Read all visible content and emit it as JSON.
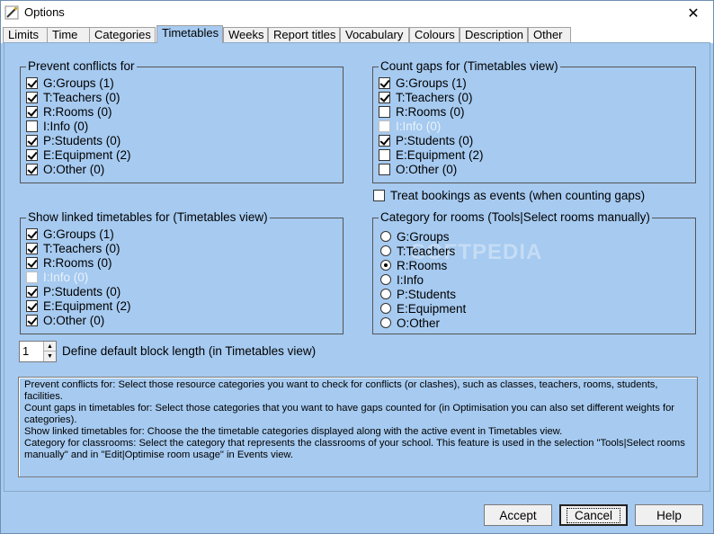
{
  "window": {
    "title": "Options",
    "close_symbol": "✕"
  },
  "tabs": [
    {
      "label": "Limits"
    },
    {
      "label": "Time"
    },
    {
      "label": "Categories"
    },
    {
      "label": "Timetables"
    },
    {
      "label": "Weeks"
    },
    {
      "label": "Report titles"
    },
    {
      "label": "Vocabulary"
    },
    {
      "label": "Colours"
    },
    {
      "label": "Description"
    },
    {
      "label": "Other"
    }
  ],
  "active_tab": "Timetables",
  "prevent_conflicts": {
    "title": "Prevent conflicts for",
    "items": [
      {
        "label": "G:Groups (1)",
        "checked": true,
        "enabled": true
      },
      {
        "label": "T:Teachers (0)",
        "checked": true,
        "enabled": true
      },
      {
        "label": "R:Rooms (0)",
        "checked": true,
        "enabled": true
      },
      {
        "label": "I:Info (0)",
        "checked": false,
        "enabled": true
      },
      {
        "label": "P:Students (0)",
        "checked": true,
        "enabled": true
      },
      {
        "label": "E:Equipment (2)",
        "checked": true,
        "enabled": true
      },
      {
        "label": "O:Other (0)",
        "checked": true,
        "enabled": true
      }
    ]
  },
  "count_gaps": {
    "title": "Count gaps for (Timetables view)",
    "items": [
      {
        "label": "G:Groups (1)",
        "checked": true,
        "enabled": true
      },
      {
        "label": "T:Teachers (0)",
        "checked": true,
        "enabled": true
      },
      {
        "label": "R:Rooms (0)",
        "checked": false,
        "enabled": true
      },
      {
        "label": "I:Info (0)",
        "checked": false,
        "enabled": false
      },
      {
        "label": "P:Students (0)",
        "checked": true,
        "enabled": true
      },
      {
        "label": "E:Equipment (2)",
        "checked": false,
        "enabled": true
      },
      {
        "label": "O:Other (0)",
        "checked": false,
        "enabled": true
      }
    ]
  },
  "treat_bookings": {
    "label": "Treat bookings as events (when counting gaps)",
    "checked": false
  },
  "show_linked": {
    "title": "Show linked timetables for (Timetables view)",
    "items": [
      {
        "label": "G:Groups (1)",
        "checked": true,
        "enabled": true
      },
      {
        "label": "T:Teachers (0)",
        "checked": true,
        "enabled": true
      },
      {
        "label": "R:Rooms (0)",
        "checked": true,
        "enabled": true
      },
      {
        "label": "I:Info (0)",
        "checked": false,
        "enabled": false
      },
      {
        "label": "P:Students (0)",
        "checked": true,
        "enabled": true
      },
      {
        "label": "E:Equipment (2)",
        "checked": true,
        "enabled": true
      },
      {
        "label": "O:Other (0)",
        "checked": true,
        "enabled": true
      }
    ]
  },
  "category_rooms": {
    "title": "Category for rooms (Tools|Select rooms manually)",
    "selected": "R:Rooms",
    "options": [
      {
        "label": "G:Groups"
      },
      {
        "label": "T:Teachers"
      },
      {
        "label": "R:Rooms"
      },
      {
        "label": "I:Info"
      },
      {
        "label": "P:Students"
      },
      {
        "label": "E:Equipment"
      },
      {
        "label": "O:Other"
      }
    ]
  },
  "block_length": {
    "value": "1",
    "label": "Define default block length (in Timetables view)"
  },
  "description": {
    "lines": [
      "Prevent conflicts for: Select those resource categories you want to check for conflicts (or clashes), such as classes, teachers, rooms, students, facilities.",
      "Count gaps in timetables for: Select those categories that you want to have gaps counted for (in Optimisation you can also set different weights for categories).",
      "Show linked timetables for: Choose the the timetable categories displayed along with the active event in Timetables view.",
      "Category for classrooms: Select the category that represents the classrooms of your school. This feature is used in the selection \"Tools|Select rooms manually\" and in \"Edit|Optimise room usage\" in Events view."
    ]
  },
  "buttons": {
    "accept": "Accept",
    "cancel": "Cancel",
    "help": "Help"
  },
  "watermark": "SOFTPEDIA",
  "colors": {
    "background": "#a6caf0",
    "titlebar": "#ffffff"
  }
}
